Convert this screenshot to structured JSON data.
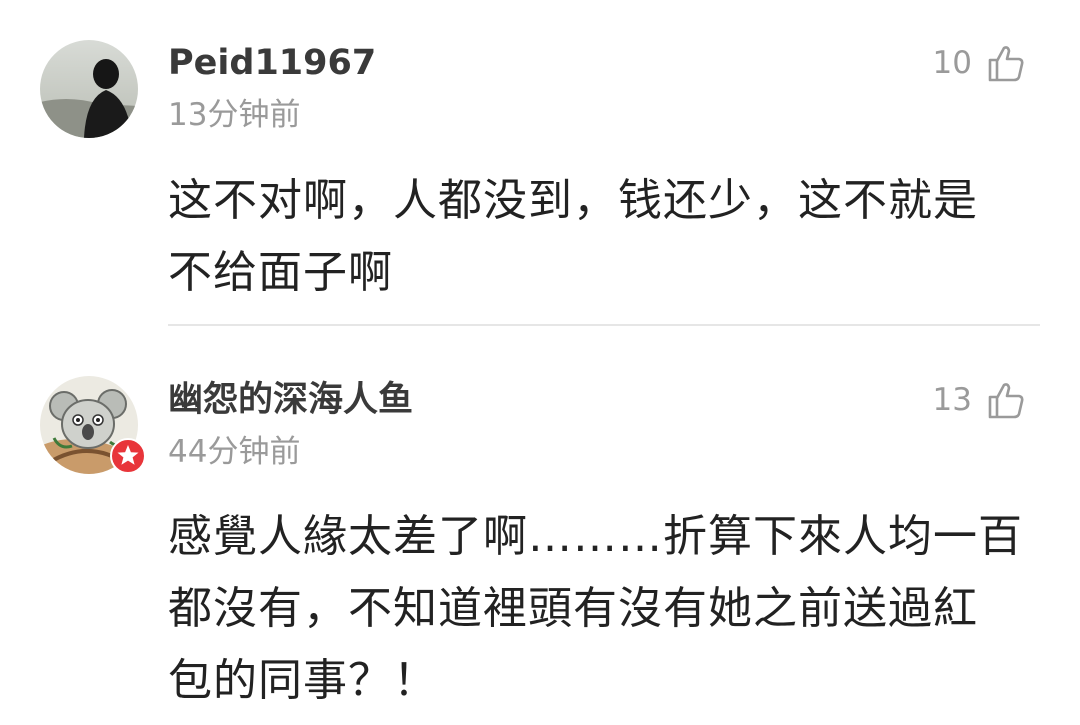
{
  "comments": [
    {
      "username": "Peid11967",
      "time": "13分钟前",
      "likes": "10",
      "text_lines": [
        "这不对啊，人都没到，钱还少，这不就是",
        "不给面子啊"
      ],
      "avatar_icon": "silhouette-avatar"
    },
    {
      "username": "幽怨的深海人鱼",
      "time": "44分钟前",
      "likes": "13",
      "text_lines": [
        "感覺人緣太差了啊………折算下來人均一百",
        "都沒有，不知道裡頭有沒有她之前送過紅",
        "包的同事？！"
      ],
      "avatar_icon": "koala-avatar",
      "badge_icon": "star-badge-icon"
    }
  ],
  "colors": {
    "username": "#3a3a3a",
    "meta": "#9a9a9a",
    "text": "#222222",
    "divider": "#e6e6e6",
    "badge": "#e8353a"
  }
}
